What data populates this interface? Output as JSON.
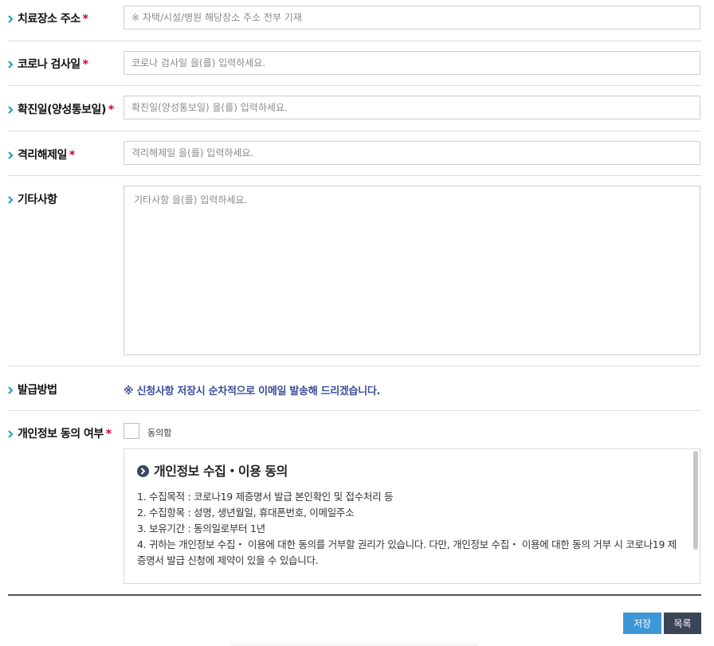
{
  "fields": {
    "treatment_address": {
      "label": "치료장소 주소",
      "required": "*",
      "placeholder": "※ 자택/시설/병원 해당장소 주소 전부 기재"
    },
    "test_date": {
      "label": "코로나 검사일",
      "required": "*",
      "placeholder": "코로나 검사일 을(를) 입력하세요."
    },
    "confirm_date": {
      "label": "확진일(양성통보일)",
      "required": "*",
      "placeholder": "확진일(양성통보일) 을(를) 입력하세요."
    },
    "release_date": {
      "label": "격리해제일",
      "required": "*",
      "placeholder": "격리해제일 을(를) 입력하세요."
    },
    "notes": {
      "label": "기타사항",
      "placeholder": "기타사항 을(를) 입력하세요."
    },
    "issue_method": {
      "label": "발급방법",
      "notice": "※ 신청사항 저장시 순차적으로 이메일 발송해 드리겠습니다."
    },
    "privacy_consent": {
      "label": "개인정보 동의 여부",
      "required": "*",
      "checkbox_label": "동의함",
      "checked": false
    }
  },
  "privacy": {
    "title": "개인정보 수집・이용 동의",
    "lines": [
      "1. 수집목적 : 코로나19 제증명서 발급 본인확인 및 접수처리 등",
      "2. 수집항목 : 성명, 생년월일, 휴대폰번호, 이메일주소",
      "3. 보유기간 : 동의일로부터 1년",
      "4. 귀하는 개인정보 수집・ 이용에 대한 동의를 거부할 권리가 있습니다. 다만, 개인정보 수집・ 이용에 대한 동의 거부 시 코로나19 제증명서 발급 신청에 제약이 있을 수 있습니다."
    ]
  },
  "buttons": {
    "save": "저장",
    "list": "목록"
  },
  "colors": {
    "accent_chevron": "#2a9bc9",
    "required": "#d0021b",
    "notice": "#3b4d9a",
    "save": "#3f96d6",
    "list": "#3b4558"
  },
  "icons": {
    "label_marker": "chevron-right-icon",
    "privacy_title": "circle-chevron-right-icon"
  }
}
